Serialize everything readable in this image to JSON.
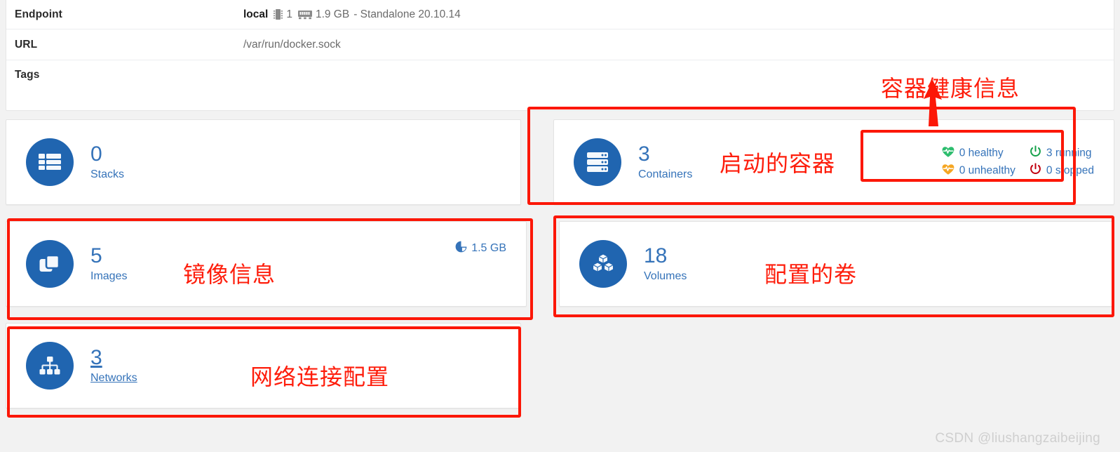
{
  "info": {
    "rows": [
      {
        "label": "Endpoint",
        "value_strong": "local",
        "cpu": "1",
        "memory": "1.9 GB",
        "suffix": "- Standalone 20.10.14",
        "icons": [
          "cpu-icon",
          "memory-icon"
        ]
      },
      {
        "label": "URL",
        "value": "/var/run/docker.sock"
      },
      {
        "label": "Tags",
        "value": ""
      }
    ]
  },
  "cards": {
    "stacks": {
      "count": "0",
      "label": "Stacks",
      "icon": "table-icon"
    },
    "containers": {
      "count": "3",
      "label": "Containers",
      "icon": "server-icon"
    },
    "images": {
      "count": "5",
      "label": "Images",
      "icon": "clone-icon",
      "size": "1.5 GB",
      "size_icon": "pie-chart-icon"
    },
    "volumes": {
      "count": "18",
      "label": "Volumes",
      "icon": "cubes-icon"
    },
    "networks": {
      "count": "3",
      "label": "Networks",
      "icon": "sitemap-icon"
    }
  },
  "health": {
    "items": [
      {
        "text": "0 healthy",
        "icon": "heartbeat-icon",
        "color": "#2dbd6e"
      },
      {
        "text": "3 running",
        "icon": "power-icon",
        "color": "#15a14a"
      },
      {
        "text": "0 unhealthy",
        "icon": "heartbeat-icon",
        "color": "#f5a623"
      },
      {
        "text": "0 stopped",
        "icon": "power-icon",
        "color": "#c1000f"
      }
    ]
  },
  "annotations": {
    "health_title": "容器健康信息",
    "containers": "启动的容器",
    "images": "镜像信息",
    "volumes": "配置的卷",
    "networks": "网络连接配置"
  },
  "watermark": "CSDN @liushangzaibeijing",
  "colors": {
    "accent_blue": "#2065b0",
    "text_blue": "#3573b9",
    "annotation_red": "#fc1707",
    "page_bg": "#f2f2f2"
  }
}
